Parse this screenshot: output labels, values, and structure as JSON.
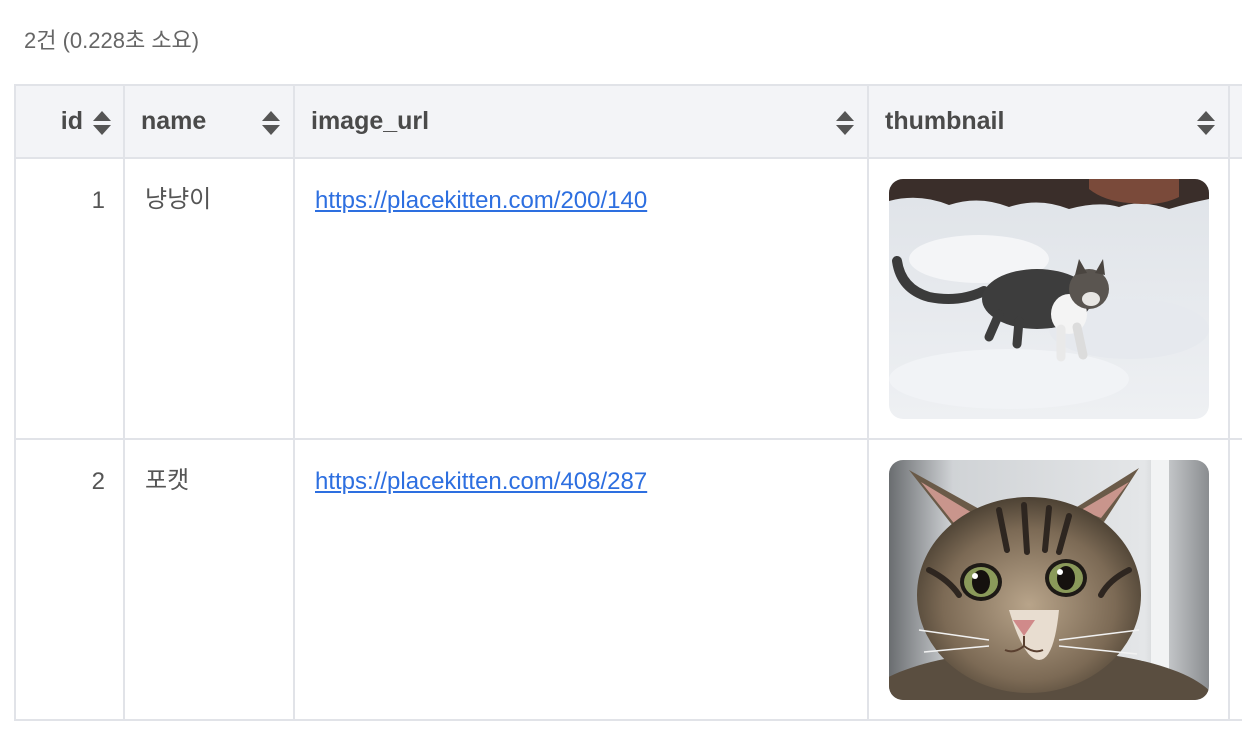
{
  "summary": {
    "text": "2건 (0.228초 소요)"
  },
  "table": {
    "columns": [
      {
        "label": "id"
      },
      {
        "label": "name"
      },
      {
        "label": "image_url"
      },
      {
        "label": "thumbnail"
      }
    ],
    "rows": [
      {
        "id": "1",
        "name": "냥냥이",
        "image_url": "https://placekitten.com/200/140",
        "thumbnail_icon": "kitten-in-snow-image"
      },
      {
        "id": "2",
        "name": "포캣",
        "image_url": "https://placekitten.com/408/287",
        "thumbnail_icon": "tabby-kitten-portrait-image"
      }
    ]
  },
  "colors": {
    "link": "#2d6fe0",
    "header_bg": "#f3f4f7",
    "border": "#e1e3e8"
  }
}
